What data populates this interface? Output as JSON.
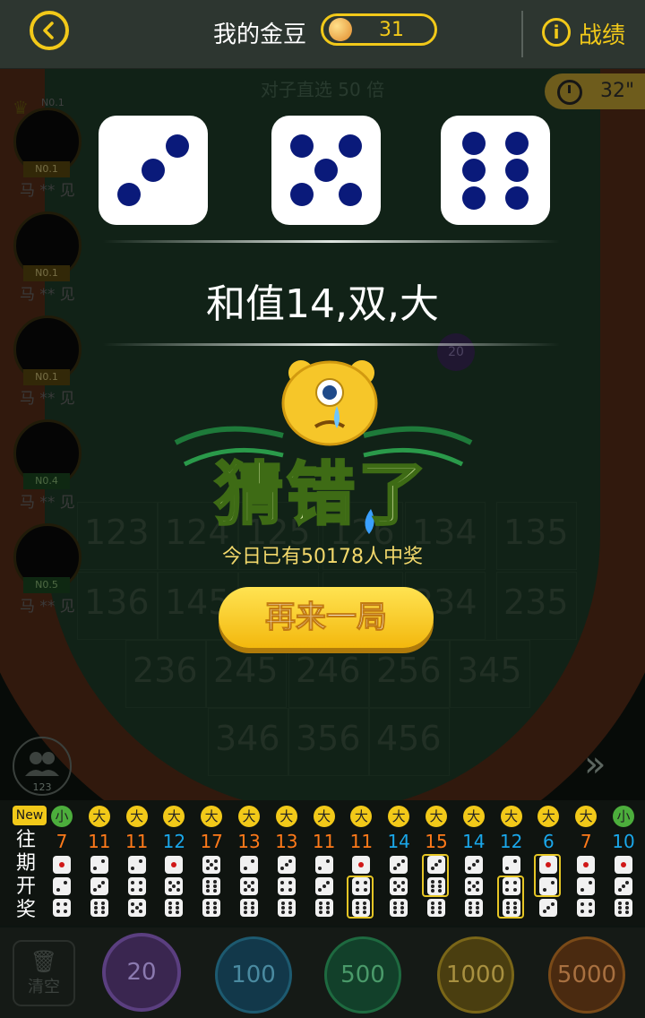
{
  "header": {
    "back_label": "back",
    "gold_label": "我的金豆",
    "gold_value": "31",
    "record_label": "战绩"
  },
  "game": {
    "pairs_title": "对子直选 50 倍",
    "timer": "32\""
  },
  "players": [
    {
      "rank": "N0.1",
      "name": "马 ** 见"
    },
    {
      "rank": "N0.1",
      "name": "马 ** 见"
    },
    {
      "rank": "N0.1",
      "name": "马 ** 见"
    },
    {
      "rank": "N0.4",
      "name": "马 ** 见"
    },
    {
      "rank": "N0.5",
      "name": "马 ** 见"
    }
  ],
  "top_rank_label": "N0.1",
  "bets": {
    "row1": [
      "123",
      "124",
      "125",
      "126",
      "134",
      "135"
    ],
    "row2": [
      "136",
      "145",
      "146",
      "156",
      "234",
      "235"
    ],
    "row3": [
      "236",
      "245",
      "246",
      "256",
      "345"
    ],
    "row4": [
      "346",
      "356",
      "456"
    ]
  },
  "placed_chip": "20",
  "dice": [
    3,
    5,
    6
  ],
  "result_text": "和值14,双,大",
  "popup": {
    "title": "猜错了",
    "winners": "今日已有50178人中奖",
    "again_button": "再来一局"
  },
  "online_count": "123",
  "history": {
    "new_tag": "New",
    "label": "往期开奖",
    "colors": {
      "small": "#4cae3c",
      "big": "#f2c919",
      "orange": "#ff7a1a",
      "blue": "#1aa7ea"
    },
    "columns": [
      {
        "size": "小",
        "sum": "7",
        "dice": [
          1,
          2,
          4
        ]
      },
      {
        "size": "大",
        "sum": "11",
        "dice": [
          2,
          3,
          6
        ]
      },
      {
        "size": "大",
        "sum": "11",
        "dice": [
          2,
          4,
          5
        ]
      },
      {
        "size": "大",
        "sum": "12",
        "dice": [
          1,
          5,
          6
        ]
      },
      {
        "size": "大",
        "sum": "17",
        "dice": [
          5,
          6,
          6
        ]
      },
      {
        "size": "大",
        "sum": "13",
        "dice": [
          2,
          5,
          6
        ]
      },
      {
        "size": "大",
        "sum": "13",
        "dice": [
          3,
          4,
          6
        ]
      },
      {
        "size": "大",
        "sum": "11",
        "dice": [
          2,
          3,
          6
        ]
      },
      {
        "size": "大",
        "sum": "11",
        "dice": [
          1,
          4,
          6
        ]
      },
      {
        "size": "大",
        "sum": "14",
        "dice": [
          3,
          5,
          6
        ]
      },
      {
        "size": "大",
        "sum": "15",
        "dice": [
          3,
          6,
          6
        ]
      },
      {
        "size": "大",
        "sum": "14",
        "dice": [
          3,
          5,
          6
        ]
      },
      {
        "size": "大",
        "sum": "12",
        "dice": [
          2,
          4,
          6
        ]
      },
      {
        "size": "大",
        "sum": "6",
        "dice": [
          1,
          2,
          3
        ]
      },
      {
        "size": "大",
        "sum": "7",
        "dice": [
          1,
          2,
          4
        ]
      },
      {
        "size": "小",
        "sum": "10",
        "dice": [
          1,
          3,
          6
        ]
      }
    ]
  },
  "chips": {
    "clear_label": "清空",
    "values": [
      "20",
      "100",
      "500",
      "1000",
      "5000"
    ]
  }
}
